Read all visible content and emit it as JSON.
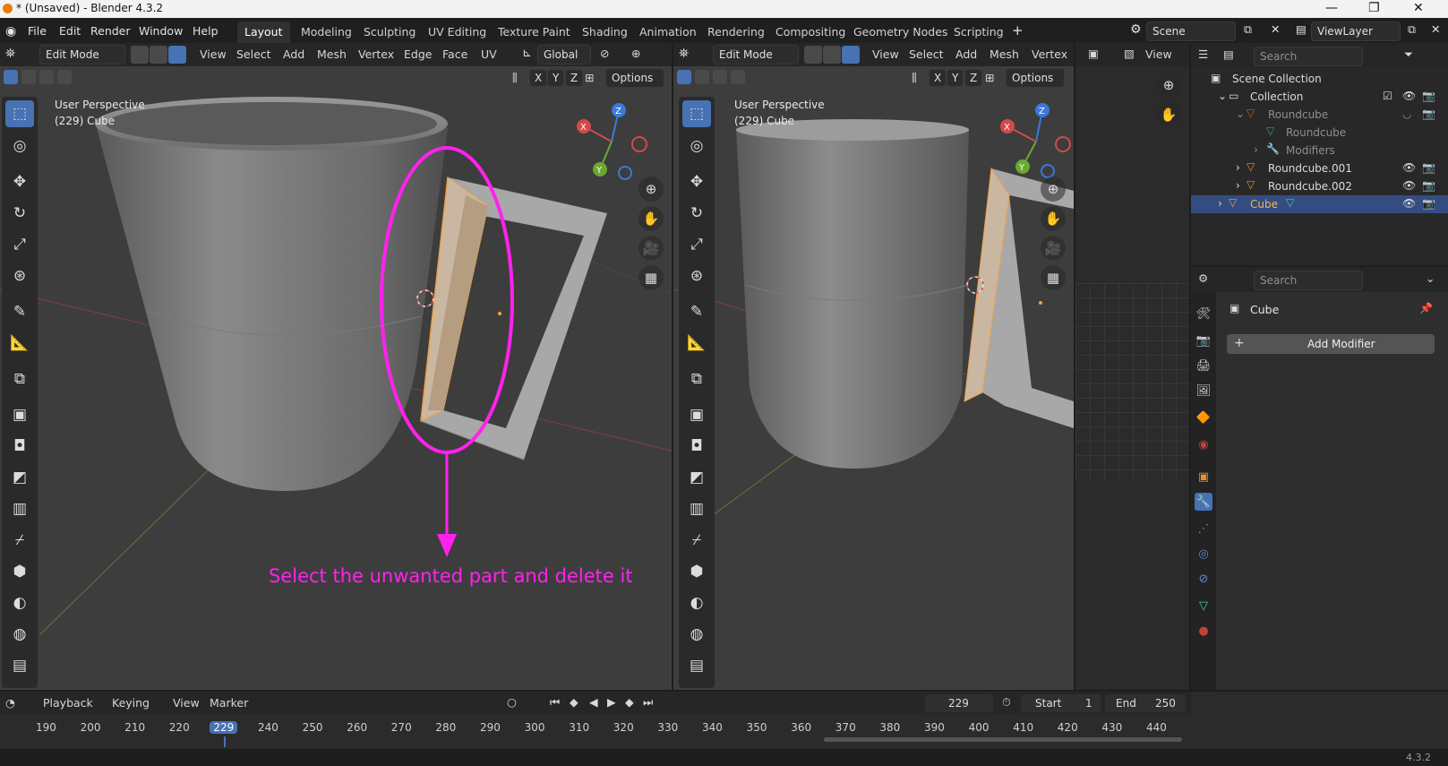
{
  "window": {
    "title": "* (Unsaved) - Blender 4.3.2",
    "controls": [
      "—",
      "❐",
      "✕"
    ]
  },
  "menu": {
    "items": [
      "File",
      "Edit",
      "Render",
      "Window",
      "Help"
    ],
    "workspaces": [
      "Layout",
      "Modeling",
      "Sculpting",
      "UV Editing",
      "Texture Paint",
      "Shading",
      "Animation",
      "Rendering",
      "Compositing",
      "Geometry Nodes",
      "Scripting"
    ],
    "add_workspace": "+",
    "scene": "Scene",
    "view_layer": "ViewLayer"
  },
  "viewport_left": {
    "mode": "Edit Mode",
    "menus": [
      "View",
      "Select",
      "Add",
      "Mesh",
      "Vertex",
      "Edge",
      "Face",
      "UV"
    ],
    "orientation": "Global",
    "axes": [
      "X",
      "Y",
      "Z"
    ],
    "options": "Options",
    "perspective": "User Perspective",
    "object_info": "(229) Cube"
  },
  "viewport_right": {
    "mode": "Edit Mode",
    "menus": [
      "View",
      "Select",
      "Add",
      "Mesh",
      "Vertex"
    ],
    "axes": [
      "X",
      "Y",
      "Z"
    ],
    "options": "Options",
    "perspective": "User Perspective",
    "object_info": "(229) Cube"
  },
  "image_panel": {
    "view": "View"
  },
  "annotation": {
    "text": "Select the unwanted part and delete it",
    "color": "#ff22ee"
  },
  "gizmo": {
    "x": "X",
    "y": "Y",
    "z": "Z"
  },
  "outliner": {
    "search_placeholder": "Search",
    "rows": [
      {
        "label": "Scene Collection"
      },
      {
        "label": "Collection"
      },
      {
        "label": "Roundcube"
      },
      {
        "label": "Roundcube"
      },
      {
        "label": "Modifiers"
      },
      {
        "label": "Roundcube.001"
      },
      {
        "label": "Roundcube.002"
      },
      {
        "label": "Cube"
      }
    ]
  },
  "properties": {
    "search_placeholder": "Search",
    "object": "Cube",
    "add_modifier": "Add Modifier"
  },
  "timeline": {
    "menus": [
      "Playback",
      "Keying",
      "View",
      "Marker"
    ],
    "current_frame": "229",
    "start_label": "Start",
    "start": "1",
    "end_label": "End",
    "end": "250",
    "ruler": [
      "190",
      "200",
      "210",
      "220",
      "229",
      "240",
      "250",
      "260",
      "270",
      "280",
      "290",
      "300",
      "310",
      "320",
      "330",
      "340",
      "350",
      "360",
      "370",
      "380",
      "390",
      "400",
      "410",
      "420",
      "430",
      "440"
    ]
  },
  "status": {
    "version": "4.3.2"
  },
  "colors": {
    "accent": "#4772b3",
    "viewport": "#3d3d3d",
    "selection_orange": "#f0a04b"
  }
}
